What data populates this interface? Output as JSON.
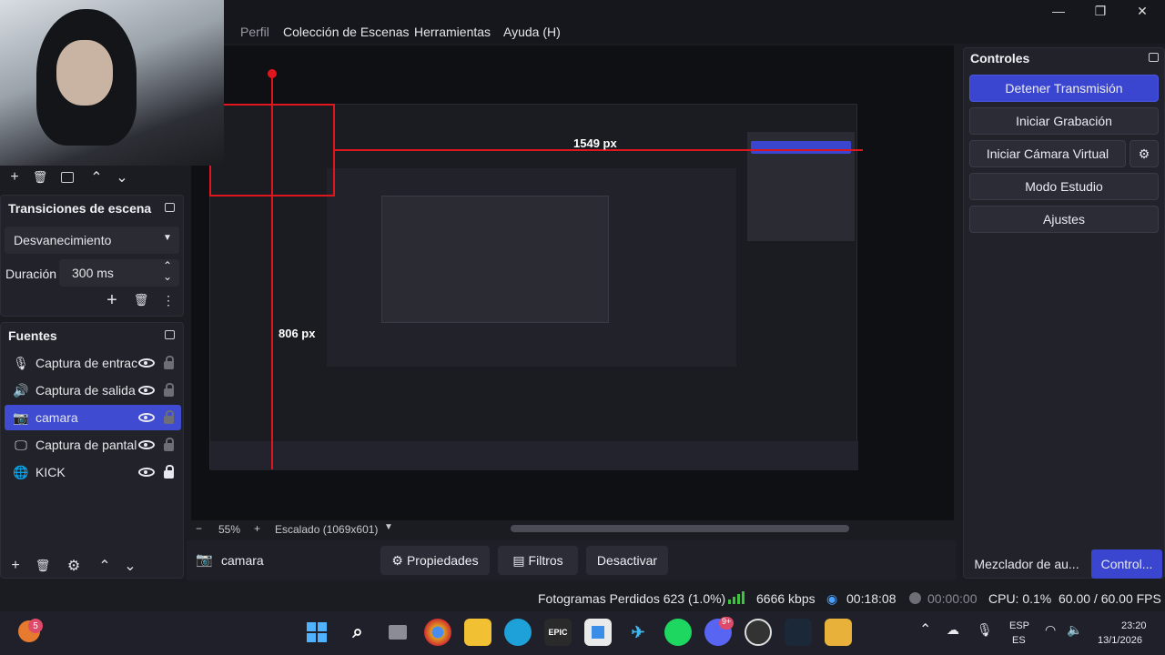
{
  "menu": {
    "items": [
      ")",
      "Perfil",
      "Colección de Escenas",
      "Herramientas",
      "Ayuda (H)"
    ]
  },
  "window": {
    "minimize": "—",
    "maximize": "❐",
    "close": "✕"
  },
  "transitions": {
    "title": "Transiciones de escena",
    "selected": "Desvanecimiento",
    "duration_label": "Duración",
    "duration_value": "300 ms"
  },
  "sources": {
    "title": "Fuentes",
    "items": [
      {
        "name": "Captura de entrac",
        "icon": "microphone-icon",
        "locked": false,
        "selected": false
      },
      {
        "name": "Captura de salida",
        "icon": "speaker-icon",
        "locked": false,
        "selected": false
      },
      {
        "name": "camara",
        "icon": "camera-icon",
        "locked": false,
        "selected": true
      },
      {
        "name": "Captura de pantal",
        "icon": "monitor-icon",
        "locked": false,
        "selected": false
      },
      {
        "name": "KICK",
        "icon": "browser-icon",
        "locked": true,
        "selected": false
      }
    ]
  },
  "controls": {
    "title": "Controles",
    "stop_stream": "Detener Transmisión",
    "start_recording": "Iniciar Grabación",
    "start_virtual_cam": "Iniciar Cámara Virtual",
    "studio_mode": "Modo Estudio",
    "settings": "Ajustes"
  },
  "preview": {
    "zoom": "55%",
    "scaled": "Escalado (1069x601)",
    "measure_width": "1549 px",
    "measure_height": "806 px"
  },
  "source_toolbar": {
    "source_name": "camara",
    "properties": "Propiedades",
    "filters": "Filtros",
    "deactivate": "Desactivar"
  },
  "dock_tabs": {
    "mixer": "Mezclador de au...",
    "controls": "Control..."
  },
  "status": {
    "dropped_frames": "Fotogramas Perdidos 623 (1.0%)",
    "bitrate": "6666 kbps",
    "stream_time": "00:18:08",
    "record_time": "00:00:00",
    "cpu": "CPU: 0.1%",
    "fps": "60.00 / 60.00 FPS"
  },
  "taskbar": {
    "lang_top": "ESP",
    "lang_bottom": "ES",
    "time": "23:20",
    "date": "13/1/2026",
    "badge_left": "5",
    "badge_discord": "9+"
  },
  "colors": {
    "accent": "#3d4bc7",
    "stop_button": "#3a46d0",
    "selected_row": "#3f4bd0",
    "measure": "#e0161e"
  }
}
